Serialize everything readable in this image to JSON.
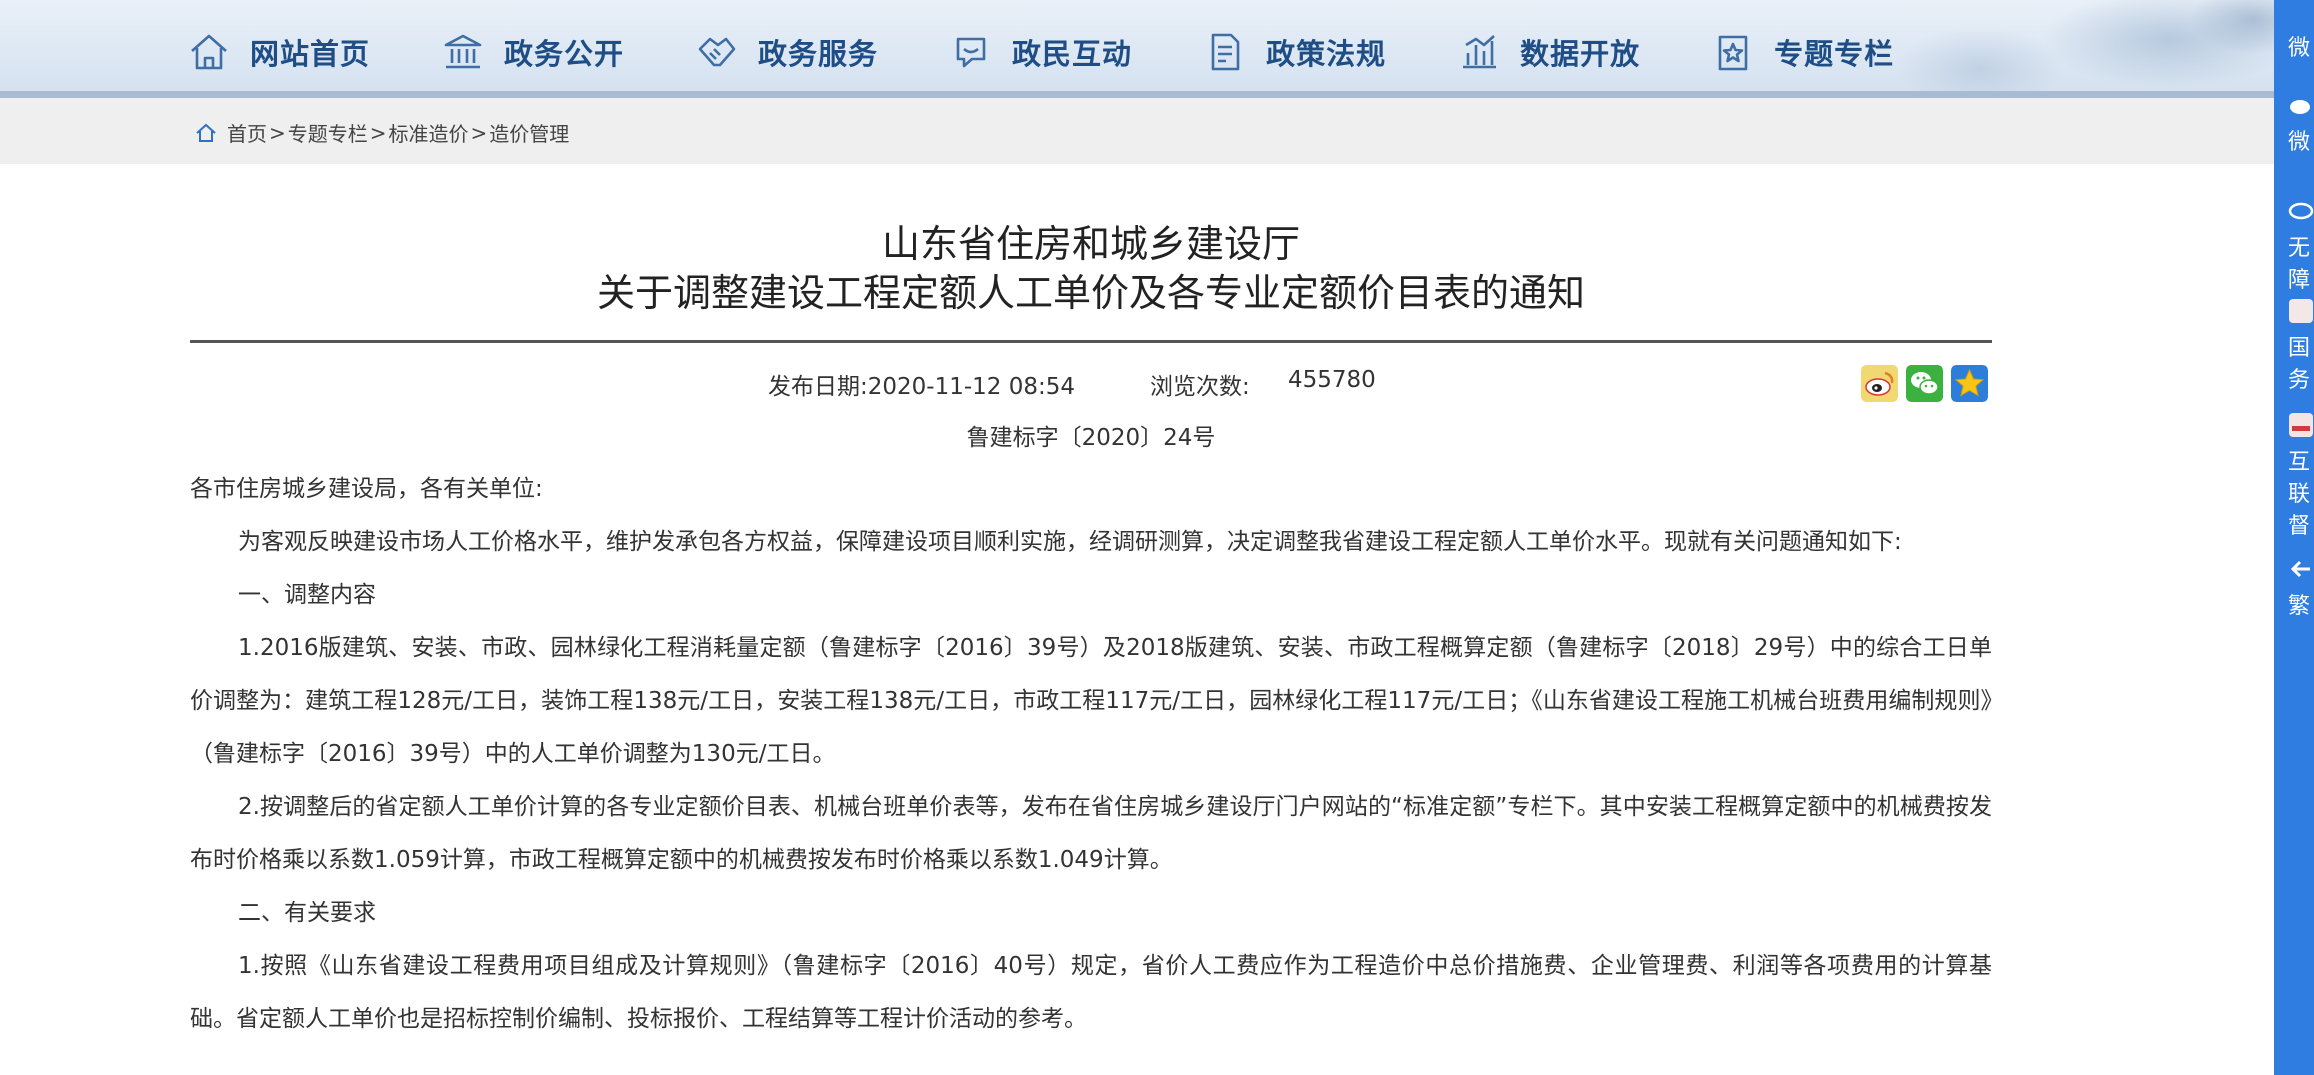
{
  "nav": {
    "items": [
      {
        "label": "网站首页",
        "icon": "home-icon"
      },
      {
        "label": "政务公开",
        "icon": "government-building-icon"
      },
      {
        "label": "政务服务",
        "icon": "handshake-icon"
      },
      {
        "label": "政民互动",
        "icon": "chat-bubble-icon"
      },
      {
        "label": "政策法规",
        "icon": "document-icon"
      },
      {
        "label": "数据开放",
        "icon": "bar-chart-icon"
      },
      {
        "label": "专题专栏",
        "icon": "star-folder-icon"
      }
    ]
  },
  "breadcrumb": {
    "items": [
      "首页",
      "专题专栏",
      "标准造价",
      "造价管理"
    ],
    "separator": ">"
  },
  "article": {
    "title_line1": "山东省住房和城乡建设厅",
    "title_line2": "关于调整建设工程定额人工单价及各专业定额价目表的通知",
    "publish_date": "发布日期:2020-11-12 08:54",
    "views_label": "浏览次数:",
    "views_count": "455780",
    "doc_number": "鲁建标字〔2020〕24号",
    "paragraphs": [
      "各市住房城乡建设局，各有关单位:",
      "为客观反映建设市场人工价格水平，维护发承包各方权益，保障建设项目顺利实施，经调研测算，决定调整我省建设工程定额人工单价水平。现就有关问题通知如下:",
      "一、调整内容",
      "1.2016版建筑、安装、市政、园林绿化工程消耗量定额（鲁建标字〔2016〕39号）及2018版建筑、安装、市政工程概算定额（鲁建标字〔2018〕29号）中的综合工日单价调整为：建筑工程128元/工日，装饰工程138元/工日，安装工程138元/工日，市政工程117元/工日，园林绿化工程117元/工日；《山东省建设工程施工机械台班费用编制规则》（鲁建标字〔2016〕39号）中的人工单价调整为130元/工日。",
      "2.按调整后的省定额人工单价计算的各专业定额价目表、机械台班单价表等，发布在省住房城乡建设厅门户网站的“标准定额”专栏下。其中安装工程概算定额中的机械费按发布时价格乘以系数1.059计算，市政工程概算定额中的机械费按发布时价格乘以系数1.049计算。",
      "二、有关要求",
      "1.按照《山东省建设工程费用项目组成及计算规则》（鲁建标字〔2016〕40号）规定，省价人工费应作为工程造价中总价措施费、企业管理费、利润等各项费用的计算基础。省定额人工单价也是招标控制价编制、投标报价、工程结算等工程计价活动的参考。"
    ]
  },
  "share": {
    "items": [
      {
        "icon": "weibo-icon",
        "color": "#e6c84b"
      },
      {
        "icon": "wechat-icon",
        "color": "#3bb13f"
      },
      {
        "icon": "favorite-star-icon",
        "color": "#2d7ed8"
      }
    ]
  },
  "sidebar": {
    "items": [
      {
        "label": "微"
      },
      {
        "label": "微"
      },
      {
        "label": "无障"
      },
      {
        "label": "国务"
      },
      {
        "label": "互联"
      },
      {
        "label": "督"
      },
      {
        "label": "繁"
      }
    ]
  },
  "colors": {
    "nav_text": "#1f4e86",
    "sidebar": "#2f7de1",
    "crumb_bg": "#efefef"
  }
}
